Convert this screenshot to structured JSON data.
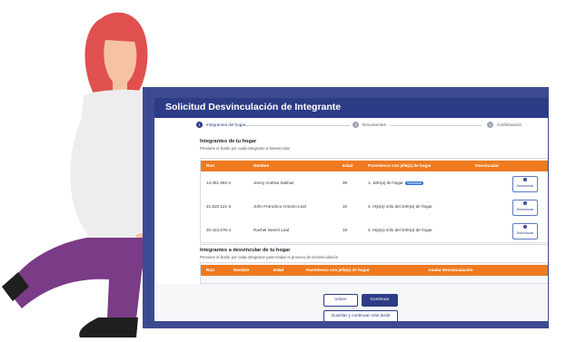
{
  "window": {
    "title": "Solicitud Desvinculación de Integrante"
  },
  "steps": [
    {
      "num": "1",
      "label": "Integrantes del hogar"
    },
    {
      "num": "2",
      "label": "Documentos"
    },
    {
      "num": "3",
      "label": "Confirmación"
    }
  ],
  "section1": {
    "title": "Integrantes de tu hogar",
    "subtitle": "Presione el botón por cada integrante a Desvincular",
    "headers": {
      "run": "Run",
      "nombre": "Nombre",
      "edad": "Edad",
      "parentesco": "Parentesco con jefe(a) de hogar",
      "desvincular": "Desvincular"
    },
    "rows": [
      {
        "run": "14.361.962-4",
        "nombre": "Jenny Andrea Salinas",
        "edad": "39",
        "parentesco": "1. Jefe(a) de hogar",
        "tag": "Solicitante",
        "button": "Desvincular"
      },
      {
        "run": "21.520.121-3",
        "nombre": "John Francisco Antonio Leal",
        "edad": "16",
        "parentesco": "4. Hijo(a) sólo del Jefe(a) de hogar",
        "tag": "",
        "button": "Desvincular"
      },
      {
        "run": "20.423.576-4",
        "nombre": "Rachel Noemí Leal",
        "edad": "19",
        "parentesco": "4. Hijo(a) sólo del Jefe(a) de hogar",
        "tag": "",
        "button": "Desvincular"
      }
    ]
  },
  "section2": {
    "title": "Integrantes a desvincular de tu hogar",
    "subtitle": "Presione el botón por cada Integrante para Anular el proceso de Desvinculación",
    "headers": {
      "run": "Run",
      "nombre": "Nombre",
      "edad": "Edad",
      "parentesco": "Parentesco con jefe(a) de hogar",
      "anular": "Anular Desvinculación"
    }
  },
  "actions": {
    "back": "Volver",
    "continue": "Continuar",
    "save": "Guardar y continuar más tarde"
  },
  "colors": {
    "navy": "#2d3c86",
    "orange": "#ef7a1f",
    "frame": "#3d4a8f",
    "hair": "#e0504e",
    "pants": "#7a3b87"
  }
}
